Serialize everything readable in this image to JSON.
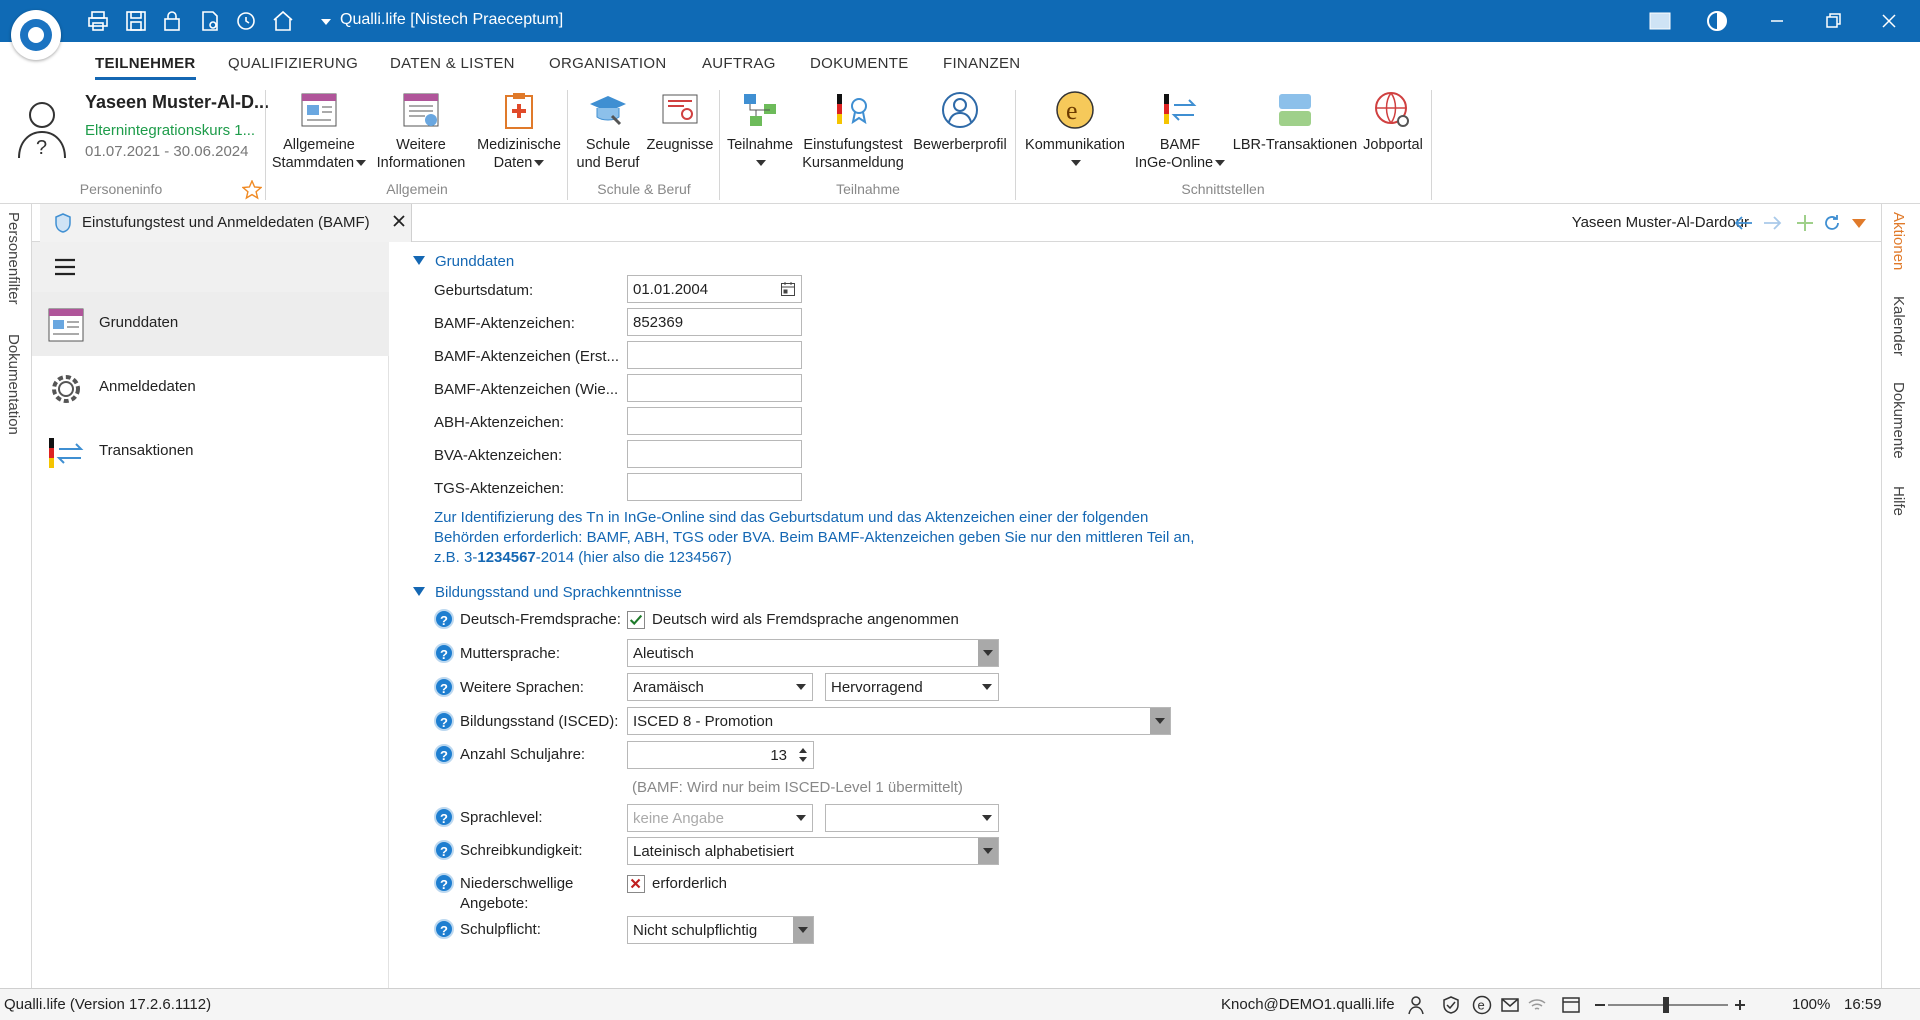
{
  "app": {
    "title": "Qualli.life [Nistech Praeceptum]",
    "accent": "#0f6ab5"
  },
  "menu": {
    "tabs": [
      "TEILNEHMER",
      "QUALIFIZIERUNG",
      "DATEN & LISTEN",
      "ORGANISATION",
      "AUFTRAG",
      "DOKUMENTE",
      "FINANZEN"
    ],
    "active": "TEILNEHMER"
  },
  "person": {
    "name": "Yaseen Muster-Al-D...",
    "course": "Elternintegrationskurs 1...",
    "dates": "01.07.2021 - 30.06.2024",
    "group_label": "Personeninfo"
  },
  "ribbon": {
    "allgemein": {
      "label": "Allgemein",
      "btn1": [
        "Allgemeine",
        "Stammdaten"
      ],
      "btn2": [
        "Weitere",
        "Informationen"
      ],
      "btn3": [
        "Medizinische",
        "Daten"
      ]
    },
    "schule": {
      "label": "Schule & Beruf",
      "btn1": [
        "Schule",
        "und Beruf"
      ],
      "btn2": "Zeugnisse"
    },
    "teilnahme": {
      "label": "Teilnahme",
      "btn1": "Teilnahme",
      "btn2": [
        "Einstufungstest",
        "Kursanmeldung"
      ],
      "btn3": "Bewerberprofil"
    },
    "schnittstellen": {
      "label": "Schnittstellen",
      "btn1": "Kommunikation",
      "btn2": [
        "BAMF",
        "InGe-Online"
      ],
      "btn3": "LBR-Transaktionen",
      "btn4": "Jobportal"
    }
  },
  "side_left": [
    "Personenfilter",
    "Dokumentation"
  ],
  "side_right": [
    "Aktionen",
    "Kalender",
    "Dokumente",
    "Hilfe"
  ],
  "doc_tab": {
    "title": "Einstufungstest und Anmeldedaten (BAMF)",
    "person": "Yaseen Muster-Al-Dardour"
  },
  "nav": {
    "items": [
      {
        "label": "Grunddaten",
        "icon": "form-icon"
      },
      {
        "label": "Anmeldedaten",
        "icon": "gear-icon"
      },
      {
        "label": "Transaktionen",
        "icon": "transfer-icon"
      }
    ]
  },
  "grunddaten": {
    "title": "Grunddaten",
    "fields": [
      {
        "label": "Geburtsdatum:",
        "value": "01.01.2004"
      },
      {
        "label": "BAMF-Aktenzeichen:",
        "value": "852369"
      },
      {
        "label": "BAMF-Aktenzeichen (Erst...",
        "value": ""
      },
      {
        "label": "BAMF-Aktenzeichen (Wie...",
        "value": ""
      },
      {
        "label": "ABH-Aktenzeichen:",
        "value": ""
      },
      {
        "label": "BVA-Aktenzeichen:",
        "value": ""
      },
      {
        "label": "TGS-Aktenzeichen:",
        "value": ""
      }
    ],
    "info_line1": "Zur Identifizierung des Tn in InGe-Online sind das Geburtsdatum und das Aktenzeichen einer der folgenden",
    "info_line2": "Behörden erforderlich: BAMF, ABH, TGS oder BVA. Beim BAMF-Aktenzeichen geben Sie nur den mittleren Teil an,",
    "info_line3_pre": "z.B. 3-",
    "info_line3_bold": "1234567",
    "info_line3_post": "-2014 (hier also die 1234567)"
  },
  "bildung": {
    "title": "Bildungsstand und Sprachkenntnisse",
    "deutsch_label": "Deutsch-Fremdsprache:",
    "deutsch_checkbox": "Deutsch wird als Fremdsprache angenommen",
    "deutsch_checked": true,
    "mutter_label": "Muttersprache:",
    "mutter_value": "Aleutisch",
    "weitere_label": "Weitere Sprachen:",
    "weitere_value": "Aramäisch",
    "weitere_level": "Hervorragend",
    "isced_label": "Bildungsstand (ISCED):",
    "isced_value": "ISCED 8 - Promotion",
    "schuljahre_label": "Anzahl Schuljahre:",
    "schuljahre_value": "13",
    "bamf_note": "(BAMF: Wird nur beim ISCED-Level 1 übermittelt)",
    "sprachlevel_label": "Sprachlevel:",
    "sprachlevel_value": "keine Angabe",
    "sprachlevel_value2": "",
    "schreib_label": "Schreibkundigkeit:",
    "schreib_value": "Lateinisch alphabetisiert",
    "nieder_label1": "Niederschwellige",
    "nieder_label2": "Angebote:",
    "nieder_checkbox": "erforderlich",
    "schulpflicht_label": "Schulpflicht:",
    "schulpflicht_value": "Nicht schulpflichtig"
  },
  "status": {
    "version": "Qualli.life (Version 17.2.6.1112)",
    "user": "Knoch@DEMO1.qualli.life",
    "zoom": "100%",
    "time": "16:59"
  }
}
